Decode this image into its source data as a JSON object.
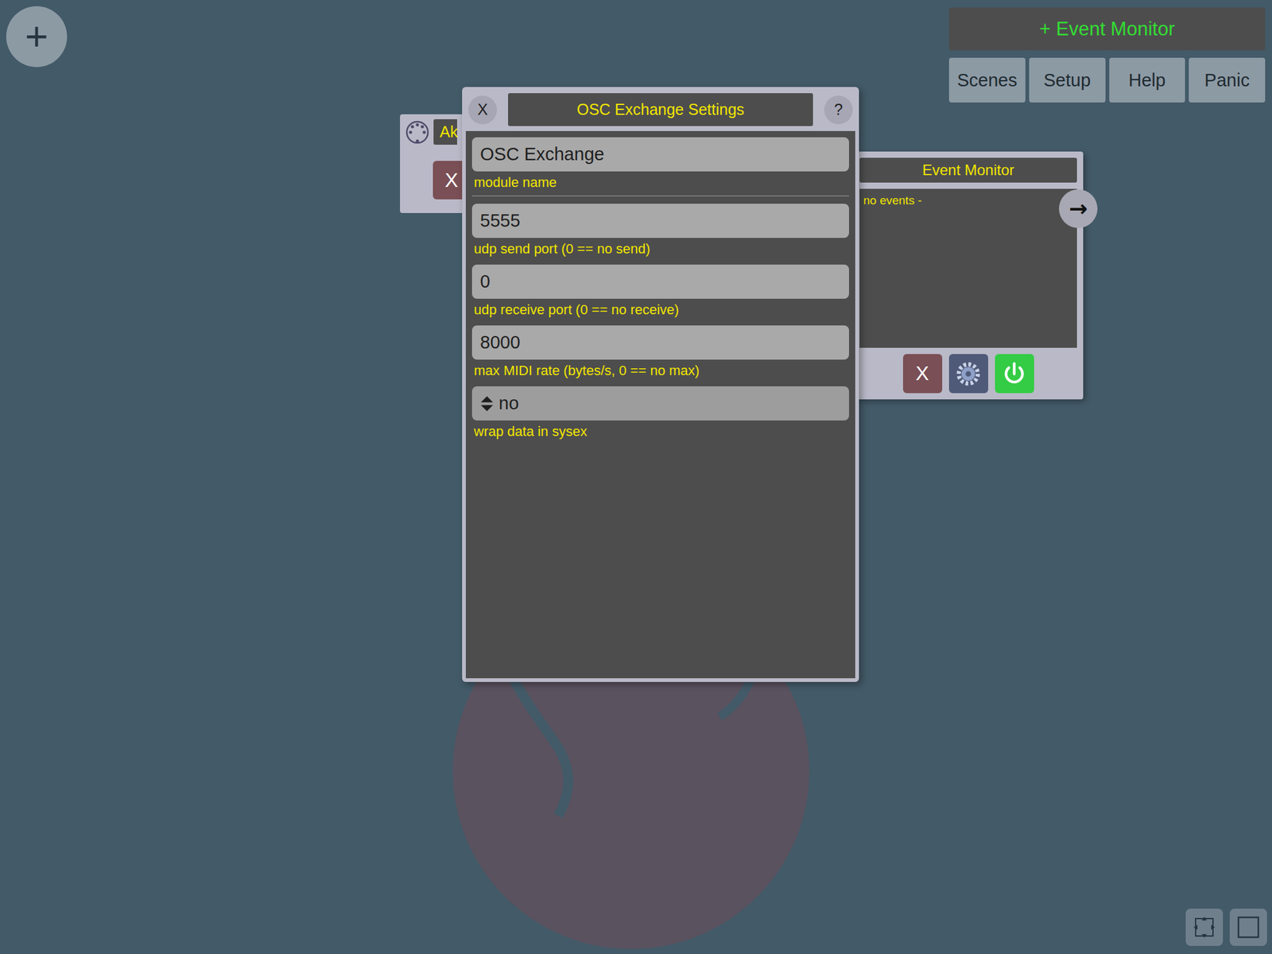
{
  "add_button": {
    "label": "+"
  },
  "toolbar": {
    "primary": "+ Event Monitor",
    "buttons": [
      "Scenes",
      "Setup",
      "Help",
      "Panic"
    ]
  },
  "midi_module": {
    "name": "Ak",
    "close": "X"
  },
  "event_monitor": {
    "title": "Event Monitor",
    "log": "no events -",
    "arrow": "→",
    "close": "X",
    "power_on": true
  },
  "dialog": {
    "title": "OSC Exchange Settings",
    "close": "X",
    "help": "?",
    "fields": [
      {
        "kind": "text",
        "value": "OSC Exchange",
        "label": "module name"
      },
      {
        "kind": "text",
        "value": "5555",
        "label": "udp send port (0 == no send)"
      },
      {
        "kind": "text",
        "value": "0",
        "label": "udp receive port (0 == no receive)"
      },
      {
        "kind": "text",
        "value": "8000",
        "label": "max MIDI rate (bytes/s, 0 == no max)"
      },
      {
        "kind": "select",
        "value": "no",
        "label": "wrap data in sysex"
      }
    ]
  }
}
